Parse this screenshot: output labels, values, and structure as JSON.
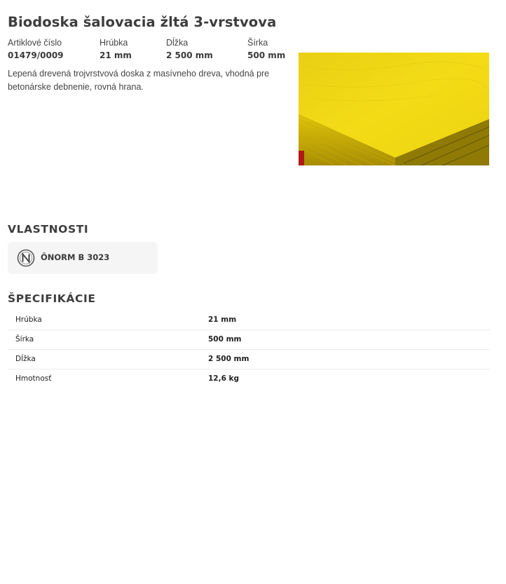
{
  "product": {
    "title": "Biodoska šalovacia žltá 3-vrstvova",
    "attributes": [
      {
        "label": "Artiklové číslo",
        "value": "01479/0009"
      },
      {
        "label": "Hrúbka",
        "value": "21 mm"
      },
      {
        "label": "Dĺžka",
        "value": "2 500 mm"
      },
      {
        "label": "Šírka",
        "value": "500 mm"
      }
    ],
    "description": "Lepená drevená trojvrstvová doska z masívneho dreva, vhodná pre betonárske debnenie, rovná hrana.",
    "image_icon": "yellow-formwork-board-photo"
  },
  "properties": {
    "title": "VLASTNOSTI",
    "items": [
      {
        "label": "ÖNORM B 3023",
        "icon": "onorm-icon"
      }
    ]
  },
  "specs": {
    "title": "ŠPECIFIKÁCIE",
    "rows": [
      {
        "label": "Hrúbka",
        "value": "21 mm"
      },
      {
        "label": "Šírka",
        "value": "500 mm"
      },
      {
        "label": "Dĺžka",
        "value": "2 500 mm"
      },
      {
        "label": "Hmotnosť",
        "value": "12,6 kg"
      }
    ]
  },
  "colors": {
    "text": "#3d3d3d",
    "card_bg": "#f5f5f5",
    "board_yellow": "#f2da0b",
    "divider": "#ececec"
  }
}
